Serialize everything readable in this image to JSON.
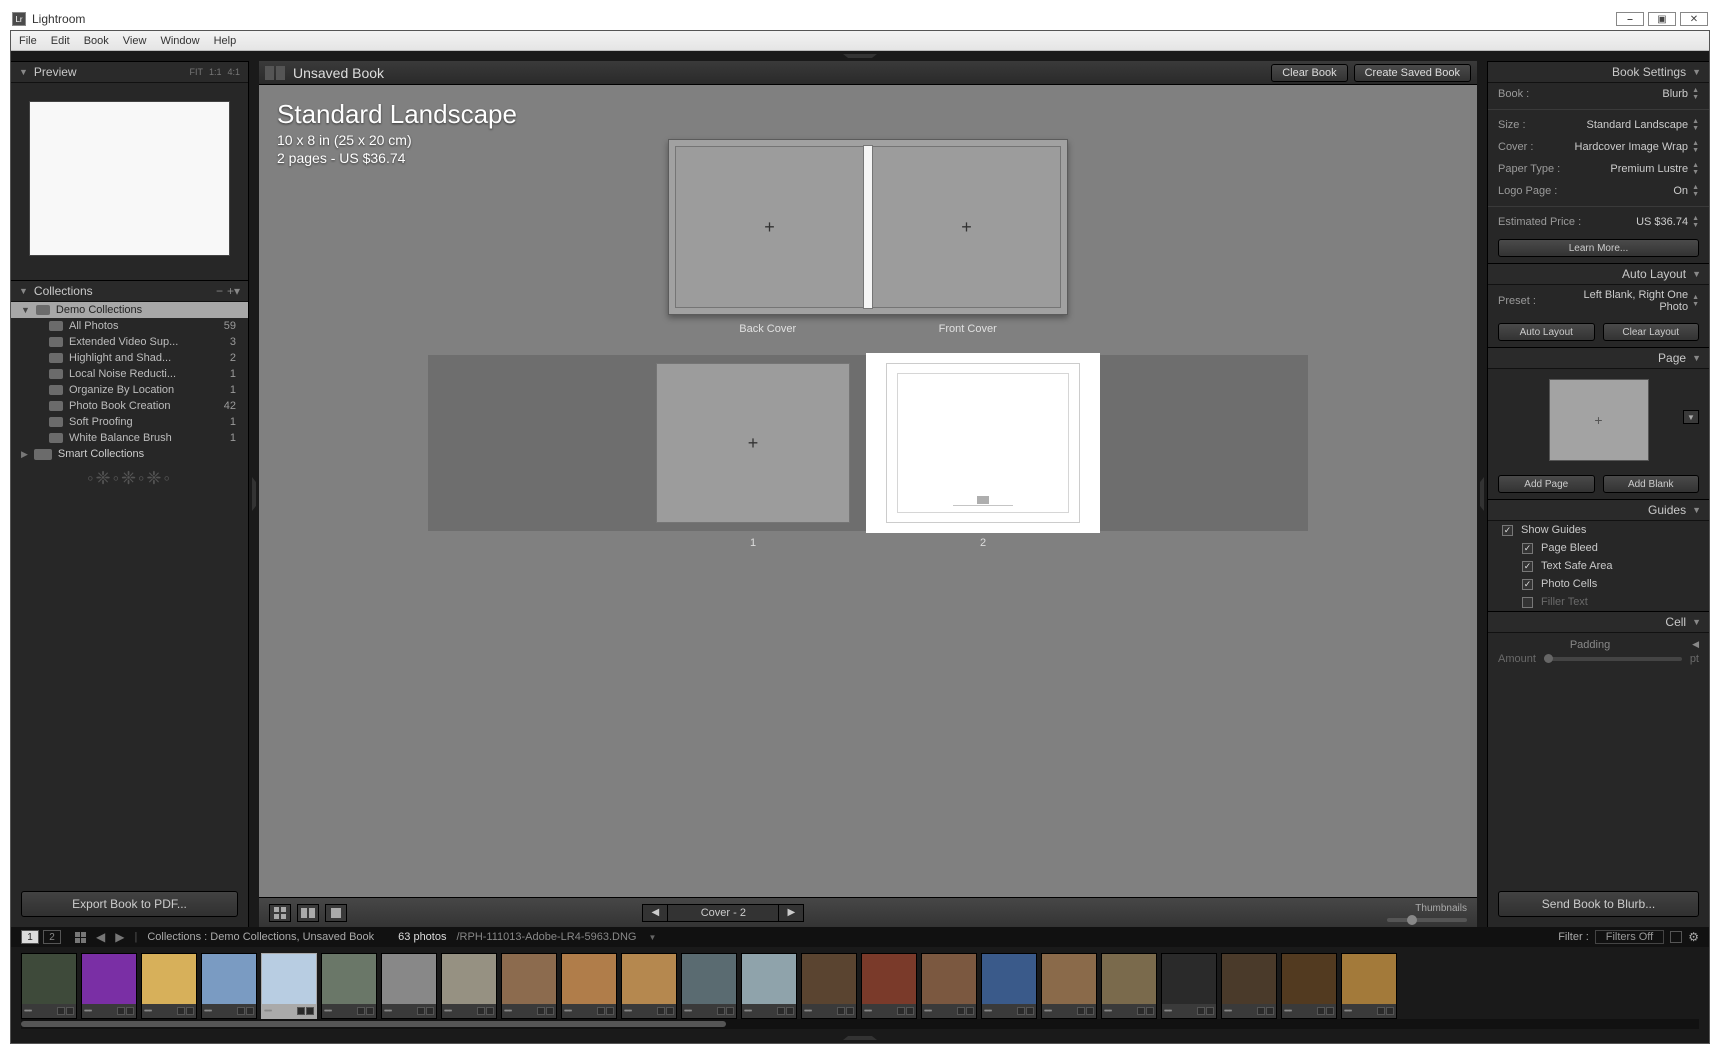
{
  "window": {
    "title": "Lightroom",
    "min": "⎯",
    "max": "▣",
    "close": "✕"
  },
  "menu": [
    "File",
    "Edit",
    "Book",
    "View",
    "Window",
    "Help"
  ],
  "left": {
    "preview": {
      "title": "Preview",
      "modes": [
        "FIT",
        "1:1",
        "4:1"
      ]
    },
    "collections": {
      "title": "Collections",
      "root_expanded": "Demo Collections",
      "items": [
        {
          "label": "All Photos",
          "count": 59
        },
        {
          "label": "Extended Video Sup...",
          "count": 3
        },
        {
          "label": "Highlight and Shad...",
          "count": 2
        },
        {
          "label": "Local Noise Reducti...",
          "count": 1
        },
        {
          "label": "Organize By Location",
          "count": 1
        },
        {
          "label": "Photo Book Creation",
          "count": 42
        },
        {
          "label": "Soft Proofing",
          "count": 1
        },
        {
          "label": "White Balance Brush",
          "count": 1
        }
      ],
      "smart": "Smart Collections"
    },
    "export": "Export Book to PDF..."
  },
  "center": {
    "bookname": "Unsaved Book",
    "clear": "Clear Book",
    "create": "Create Saved Book",
    "title": "Standard Landscape",
    "subtitle1": "10 x 8 in (25 x 20 cm)",
    "subtitle2": "2 pages - US $36.74",
    "cover": {
      "back": "Back Cover",
      "front": "Front Cover"
    },
    "pages": {
      "p1": "1",
      "p2": "2"
    },
    "pager": {
      "label": "Cover - 2"
    },
    "thumbs": "Thumbnails"
  },
  "right": {
    "bookSettings": {
      "title": "Book Settings",
      "rows": {
        "book": {
          "lbl": "Book :",
          "val": "Blurb"
        },
        "size": {
          "lbl": "Size :",
          "val": "Standard Landscape"
        },
        "cover": {
          "lbl": "Cover :",
          "val": "Hardcover Image Wrap"
        },
        "paper": {
          "lbl": "Paper Type :",
          "val": "Premium Lustre"
        },
        "logo": {
          "lbl": "Logo Page :",
          "val": "On"
        }
      },
      "price": {
        "lbl": "Estimated Price :",
        "val": "US $36.74"
      },
      "learn": "Learn More..."
    },
    "autoLayout": {
      "title": "Auto Layout",
      "preset": {
        "lbl": "Preset :",
        "val": "Left Blank, Right One Photo"
      },
      "auto": "Auto Layout",
      "clear": "Clear Layout"
    },
    "page": {
      "title": "Page",
      "addPage": "Add Page",
      "addBlank": "Add Blank"
    },
    "guides": {
      "title": "Guides",
      "show": "Show Guides",
      "bleed": "Page Bleed",
      "safe": "Text Safe Area",
      "cells": "Photo Cells",
      "filler": "Filler Text"
    },
    "cell": {
      "title": "Cell",
      "padding": "Padding",
      "amount": "Amount",
      "pt": "pt"
    },
    "send": "Send Book to Blurb..."
  },
  "status": {
    "breadcrumb": "Collections : Demo Collections, Unsaved Book",
    "count": "63 photos",
    "file": "/RPH-111013-Adobe-LR4-5963.DNG",
    "filter": "Filter :",
    "filterval": "Filters Off"
  },
  "film_colors": [
    "#3e4a3a",
    "#7a2fa5",
    "#d7b05a",
    "#7a9bc2",
    "#b8cde2",
    "#6a7768",
    "#888",
    "#969182",
    "#8c6b4e",
    "#b07d4a",
    "#b5884f",
    "#5a6b71",
    "#8fa3ab",
    "#5a4430",
    "#7a3a2a",
    "#7b5840",
    "#3a5a8a",
    "#8a6a4a",
    "#7a6a4c",
    "#2a2a2a",
    "#4a3a2a",
    "#523a20",
    "#a37a3a"
  ]
}
